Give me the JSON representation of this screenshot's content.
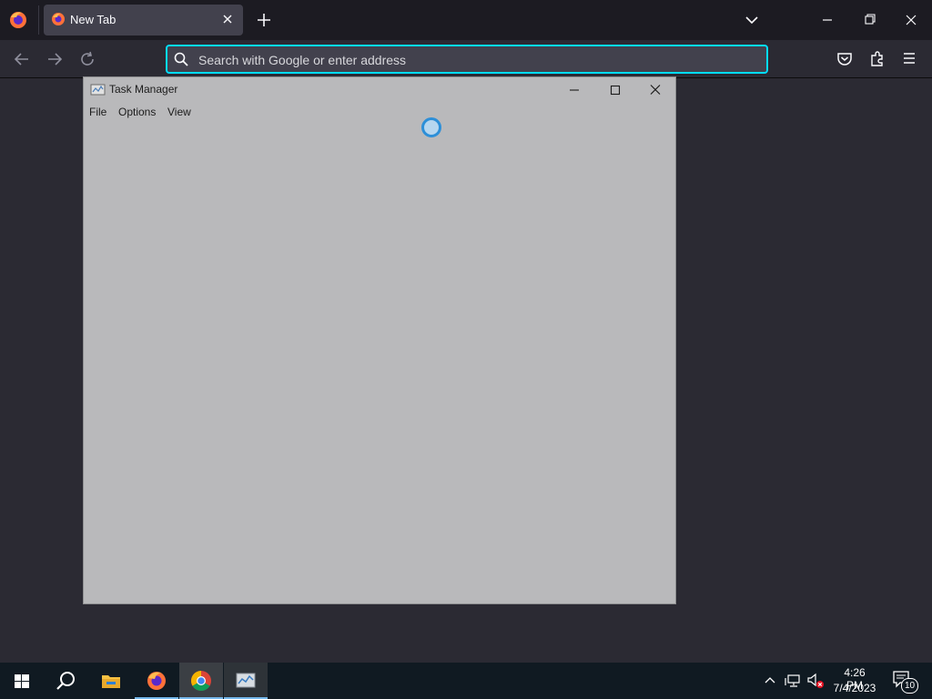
{
  "browser": {
    "tab": {
      "title": "New Tab"
    },
    "urlbar": {
      "placeholder": "Search with Google or enter address"
    },
    "accent_color": "#00ddff"
  },
  "task_manager": {
    "title": "Task Manager",
    "menu": [
      "File",
      "Options",
      "View"
    ],
    "status": "loading"
  },
  "taskbar": {
    "apps": [
      "start",
      "search",
      "file-explorer",
      "firefox",
      "chrome",
      "task-manager"
    ],
    "clock": {
      "time": "4:26 PM",
      "date": "7/4/2023"
    },
    "notification_count": "10"
  }
}
